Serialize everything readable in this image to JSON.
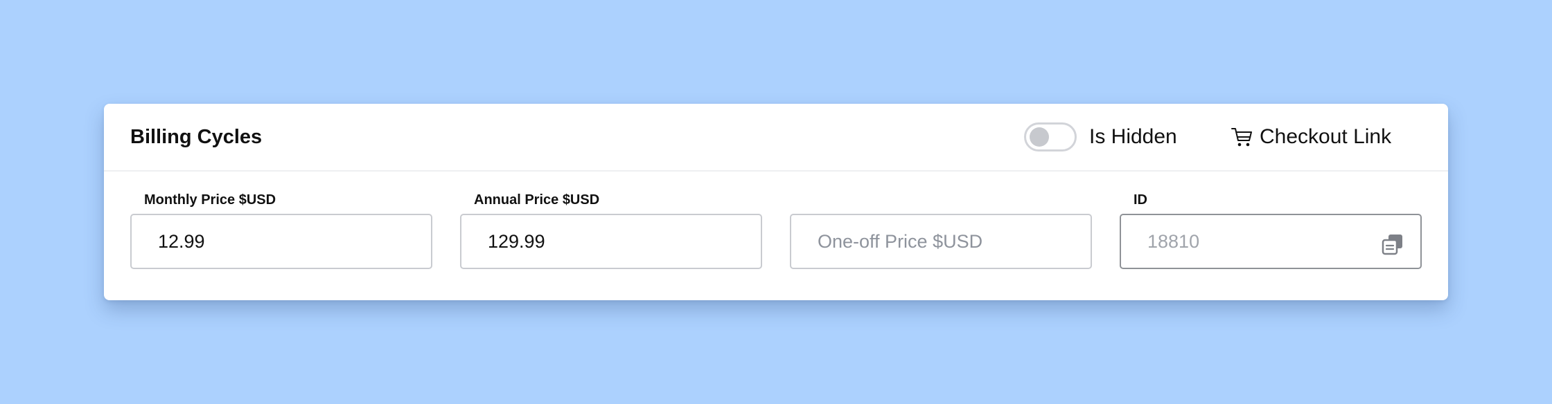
{
  "card": {
    "title": "Billing Cycles",
    "toggle": {
      "label": "Is Hidden",
      "state": "off"
    },
    "checkout": {
      "label": "Checkout Link",
      "icon": "cart-icon"
    }
  },
  "fields": {
    "monthly": {
      "label": "Monthly Price $USD",
      "value": "12.99"
    },
    "annual": {
      "label": "Annual Price $USD",
      "value": "129.99"
    },
    "oneoff": {
      "placeholder": "One-off Price $USD",
      "value": ""
    },
    "id": {
      "label": "ID",
      "value": "18810",
      "icon": "copy-icon"
    }
  },
  "colors": {
    "background": "#acd1fe",
    "card": "#ffffff",
    "toggle_knob": "#c7c9ce",
    "border": "#c9cbd0"
  }
}
